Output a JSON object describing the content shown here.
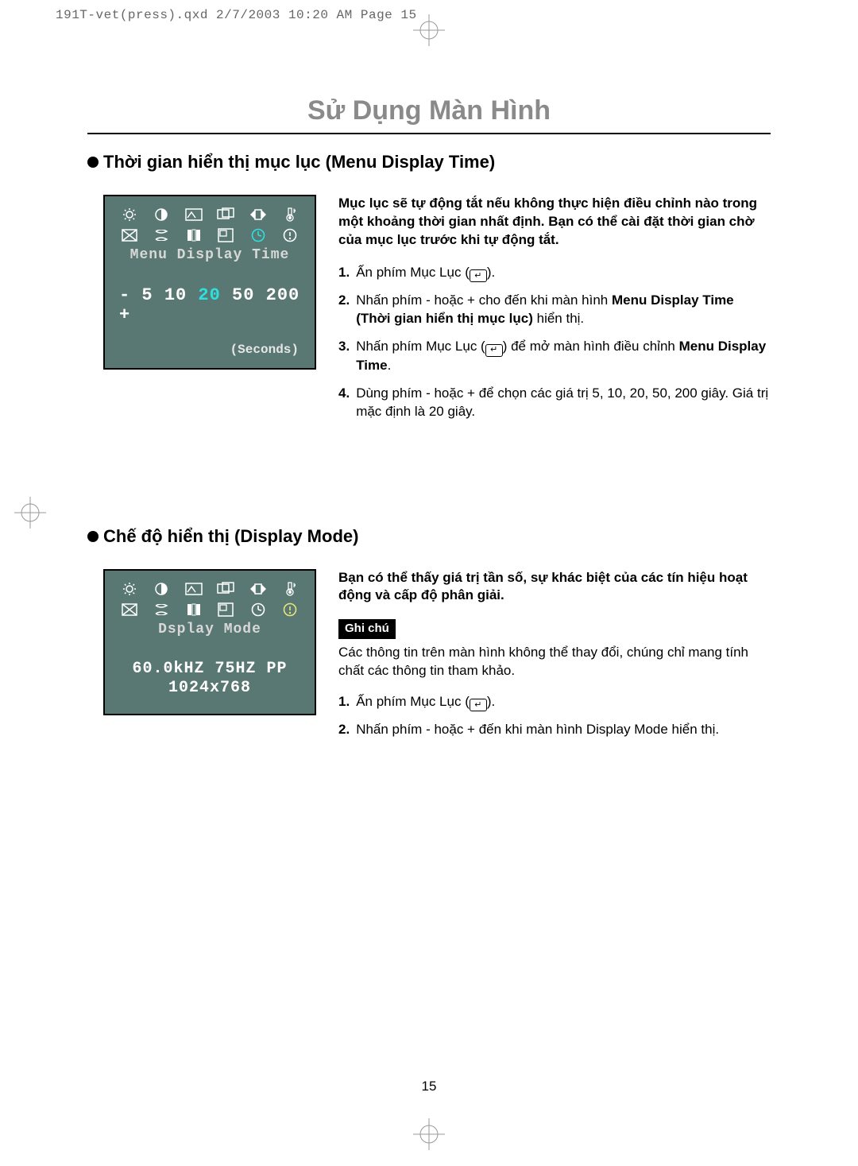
{
  "print_header": "191T-vet(press).qxd  2/7/2003  10:20 AM  Page 15",
  "main_title": "Sử Dụng Màn Hình",
  "page_number": "15",
  "section1": {
    "title": "Thời gian hiển thị mục lục (Menu Display Time)",
    "osd": {
      "label": "Menu Display Time",
      "minus": "-",
      "values": [
        "5",
        "10",
        "20",
        "50",
        "200"
      ],
      "plus": "+",
      "unit": "(Seconds)",
      "selected_index": 2
    },
    "intro": "Mục lục sẽ tự động tắt nếu không thực hiện điều chỉnh nào trong một khoảng thời gian nhất định. Bạn có thể cài đặt thời gian chờ của mục lục trước khi tự động tắt.",
    "steps": [
      {
        "num": "1.",
        "text_pre": "Ấn phím Mục Lục (",
        "text_post": ")."
      },
      {
        "num": "2.",
        "text_pre": "Nhấn phím - hoặc + cho đến khi màn hình ",
        "bold": "Menu Display Time (Thời gian hiển thị mục lục)",
        "text_post": " hiển thị."
      },
      {
        "num": "3.",
        "text_pre": "Nhấn phím Mục Lục (",
        "text_mid": ") để mở màn hình điều chỉnh ",
        "bold": "Menu Display Time",
        "text_post": "."
      },
      {
        "num": "4.",
        "text": "Dùng phím - hoặc + để chọn các giá trị 5, 10, 20, 50, 200 giây. Giá trị mặc định là 20 giây."
      }
    ]
  },
  "section2": {
    "title": "Chế độ hiển thị (Display Mode)",
    "osd": {
      "label": "Dsplay Mode",
      "line1": "60.0kHZ 75HZ PP",
      "line2": "1024x768"
    },
    "intro": "Bạn có thể thấy giá trị tần số, sự khác biệt của các tín hiệu hoạt động và cấp độ phân giải.",
    "note_label": "Ghi chú",
    "note_text": "Các thông tin trên màn hình không thể thay đổi, chúng chỉ mang tính chất các thông tin tham khảo.",
    "steps": [
      {
        "num": "1.",
        "text_pre": "Ấn phím Mục Lục (",
        "text_post": ")."
      },
      {
        "num": "2.",
        "text": "Nhấn phím - hoặc + đến khi màn hình Display Mode hiển thị."
      }
    ]
  }
}
